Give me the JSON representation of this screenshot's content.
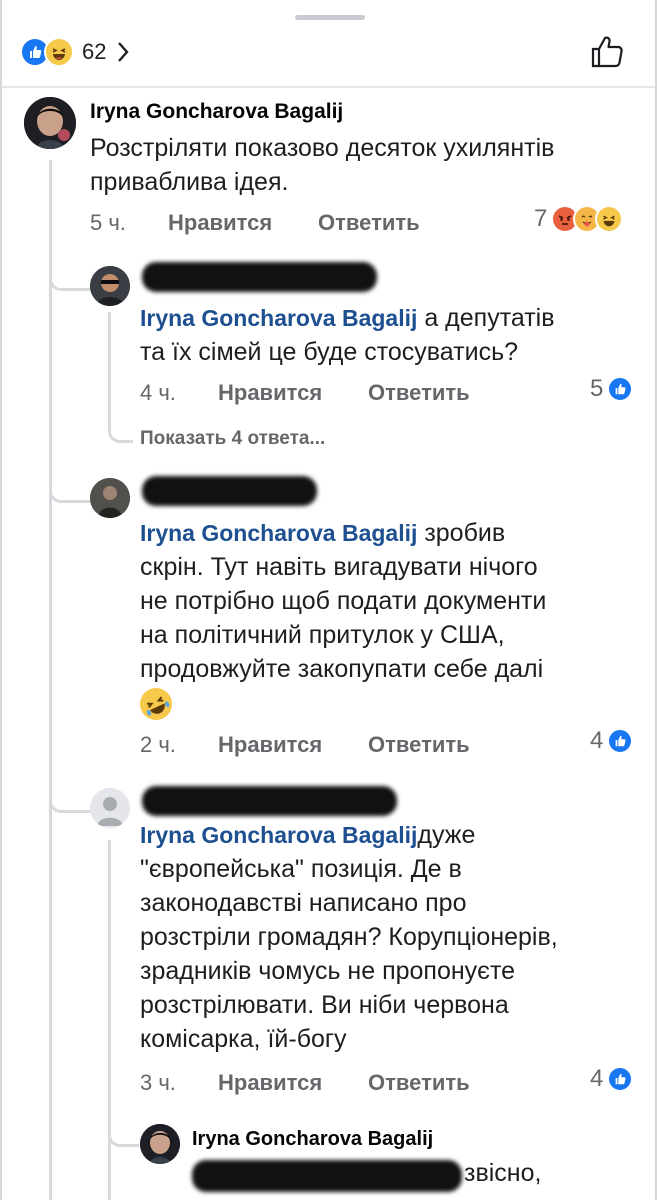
{
  "header": {
    "reaction_count": "62"
  },
  "comments": [
    {
      "author": "Iryna Goncharova Bagalij",
      "lines": [
        "Розстріляти показово десяток ухилянтів",
        "приваблива ідея."
      ],
      "time": "5 ч.",
      "like_label": "Нравится",
      "reply_label": "Ответить",
      "reaction_count": "7"
    },
    {
      "mention": "Iryna Goncharova Bagalij",
      "line1_after": " а депутатів",
      "lines": [
        "та їх сімей це буде стосуватись?"
      ],
      "time": "4 ч.",
      "like_label": "Нравится",
      "reply_label": "Ответить",
      "reaction_count": "5",
      "show_replies": "Показать 4 ответа..."
    },
    {
      "mention": "Iryna Goncharova Bagalij",
      "line1_after": " зробив",
      "lines": [
        "скрін. Тут навіть вигадувати нічого",
        "не потрібно щоб подати документи",
        "на політичний притулок у США,",
        "продовжуйте закопупати себе далі"
      ],
      "time": "2 ч.",
      "like_label": "Нравится",
      "reply_label": "Ответить",
      "reaction_count": "4"
    },
    {
      "mention": "Iryna Goncharova Bagalij",
      "line1_after": "дуже",
      "lines": [
        "\"європейська\" позиція. Де в",
        "законодавстві написано про",
        "розстріли громадян? Корупціонерів,",
        "зрадників чомусь не пропонуєте",
        "розстрілювати. Ви ніби червона",
        "комісарка, їй-богу"
      ],
      "time": "3 ч.",
      "like_label": "Нравится",
      "reply_label": "Ответить",
      "reaction_count": "4"
    },
    {
      "author": "Iryna Goncharova Bagalij",
      "partial_text": "звісно,"
    }
  ],
  "colors": {
    "like_blue": "#1877f2",
    "mention": "#1d4f91",
    "meta_gray": "#65676b"
  }
}
